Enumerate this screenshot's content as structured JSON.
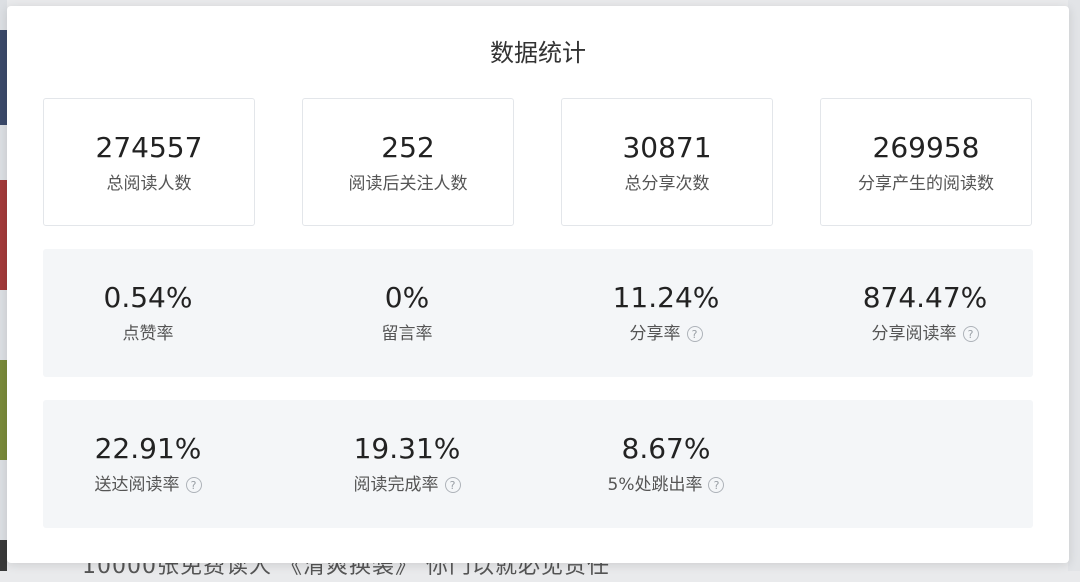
{
  "modal": {
    "title": "数据统计"
  },
  "summary_cards": [
    {
      "value": "274557",
      "label": "总阅读人数"
    },
    {
      "value": "252",
      "label": "阅读后关注人数"
    },
    {
      "value": "30871",
      "label": "总分享次数"
    },
    {
      "value": "269958",
      "label": "分享产生的阅读数"
    }
  ],
  "rates_row1": [
    {
      "value": "0.54%",
      "label": "点赞率",
      "help": false
    },
    {
      "value": "0%",
      "label": "留言率",
      "help": false
    },
    {
      "value": "11.24%",
      "label": "分享率",
      "help": true
    },
    {
      "value": "874.47%",
      "label": "分享阅读率",
      "help": true
    }
  ],
  "rates_row2": [
    {
      "value": "22.91%",
      "label": "送达阅读率",
      "help": true
    },
    {
      "value": "19.31%",
      "label": "阅读完成率",
      "help": true
    },
    {
      "value": "8.67%",
      "label": "5%处跳出率",
      "help": true
    }
  ],
  "help_glyph": "?",
  "background": {
    "partial_text": "10000张免费读人 《清爽换装》 你门以就必见责任"
  }
}
